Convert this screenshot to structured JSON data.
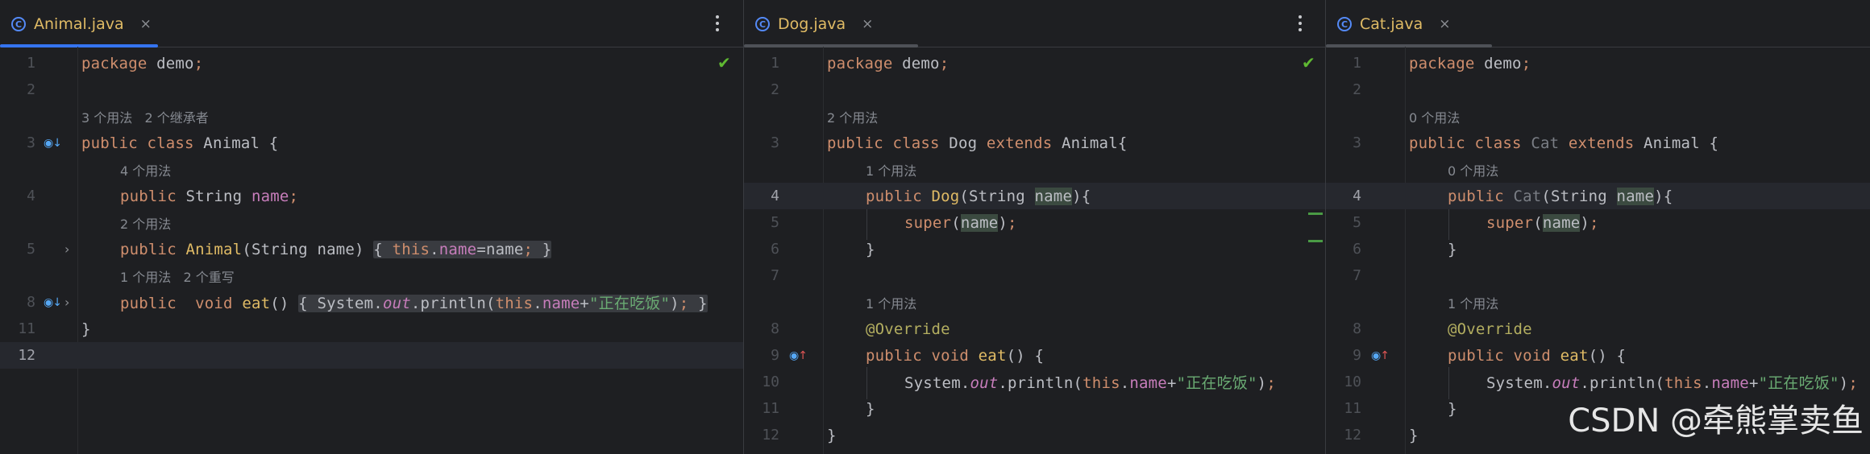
{
  "panes": [
    {
      "tab": {
        "title": "Animal.java",
        "close": "×",
        "icon": "class-c-icon"
      },
      "lines": [
        {
          "n": "1",
          "code": "package demo;"
        },
        {
          "n": "2",
          "code": ""
        },
        {
          "n": "",
          "hint": "3 个用法   2 个继承者"
        },
        {
          "n": "3",
          "code": "public class Animal {"
        },
        {
          "n": "",
          "hint": "4 个用法"
        },
        {
          "n": "4",
          "code": "public String name;"
        },
        {
          "n": "",
          "hint": "2 个用法"
        },
        {
          "n": "5",
          "code": "public Animal(String name) { this.name=name; }"
        },
        {
          "n": "",
          "hint": "1 个用法   2 个重写"
        },
        {
          "n": "8",
          "code": "public  void eat() { System.out.println(this.name+\"正在吃饭\"); }"
        },
        {
          "n": "11",
          "code": "}"
        },
        {
          "n": "12",
          "code": ""
        }
      ]
    },
    {
      "tab": {
        "title": "Dog.java",
        "close": "×",
        "icon": "class-c-icon"
      },
      "lines": [
        {
          "n": "1",
          "code": "package demo;"
        },
        {
          "n": "2",
          "code": ""
        },
        {
          "n": "",
          "hint": "2 个用法"
        },
        {
          "n": "3",
          "code": "public class Dog extends Animal{"
        },
        {
          "n": "",
          "hint": "1 个用法"
        },
        {
          "n": "4",
          "code": "public Dog(String name){"
        },
        {
          "n": "5",
          "code": "super(name);"
        },
        {
          "n": "6",
          "code": "}"
        },
        {
          "n": "7",
          "code": ""
        },
        {
          "n": "",
          "hint": "1 个用法"
        },
        {
          "n": "8",
          "code": "@Override"
        },
        {
          "n": "9",
          "code": "public void eat() {"
        },
        {
          "n": "10",
          "code": "System.out.println(this.name+\"正在吃饭\");"
        },
        {
          "n": "11",
          "code": "}"
        },
        {
          "n": "12",
          "code": "}"
        }
      ]
    },
    {
      "tab": {
        "title": "Cat.java",
        "close": "×",
        "icon": "class-c-icon"
      },
      "lines": [
        {
          "n": "1",
          "code": "package demo;"
        },
        {
          "n": "2",
          "code": ""
        },
        {
          "n": "",
          "hint": "0 个用法"
        },
        {
          "n": "3",
          "code": "public class Cat extends Animal {"
        },
        {
          "n": "",
          "hint": "0 个用法"
        },
        {
          "n": "4",
          "code": "public Cat(String name){"
        },
        {
          "n": "5",
          "code": "super(name);"
        },
        {
          "n": "6",
          "code": "}"
        },
        {
          "n": "7",
          "code": ""
        },
        {
          "n": "",
          "hint": "1 个用法"
        },
        {
          "n": "8",
          "code": "@Override"
        },
        {
          "n": "9",
          "code": "public void eat() {"
        },
        {
          "n": "10",
          "code": "System.out.println(this.name+\"正在吃饭\");"
        },
        {
          "n": "11",
          "code": "}"
        },
        {
          "n": "12",
          "code": "}"
        }
      ]
    }
  ],
  "watermark": "CSDN @牵熊掌卖鱼",
  "colors": {
    "background": "#1e1f22",
    "keyword": "#cf8e6d",
    "method_decl": "#e0bb65",
    "field": "#c77dbb",
    "string": "#6aab73",
    "annotation": "#b3ae60",
    "active_tab_underline": "#3574f0",
    "check": "#5fb832"
  }
}
